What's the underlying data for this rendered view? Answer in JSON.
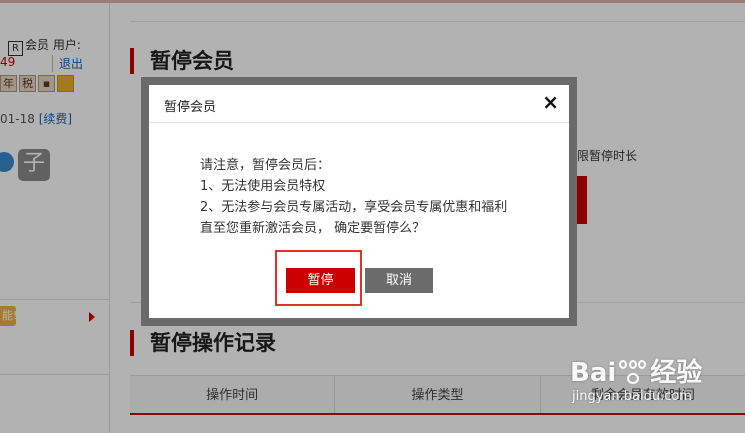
{
  "sidebar": {
    "member_label": "会员 用户:",
    "vip_badge": "R",
    "points": "49",
    "logout": "退出",
    "icons": [
      "年",
      "税"
    ],
    "expiry_date": "01-18",
    "renew": "[续费]",
    "avatar_char": "子",
    "yellow_button_text": "能!"
  },
  "main": {
    "section1_title": "暂停会员",
    "partial_text": "不限暂停时长",
    "section2_title": "暂停操作记录",
    "table_headers": [
      "操作时间",
      "操作类型",
      "剩余会员有效时间"
    ]
  },
  "dialog": {
    "title": "暂停会员",
    "close_symbol": "×",
    "lines": [
      "请注意，暂停会员后：",
      "1、无法使用会员特权",
      "2、无法参与会员专属活动，享受会员专属优惠和福利",
      "直至您重新激活会员， 确定要暂停么？"
    ],
    "confirm_label": "暂停",
    "cancel_label": "取消"
  },
  "watermark": {
    "logo_left": "Bai",
    "logo_right": "经验",
    "url": "jingyan.baidu.com"
  }
}
